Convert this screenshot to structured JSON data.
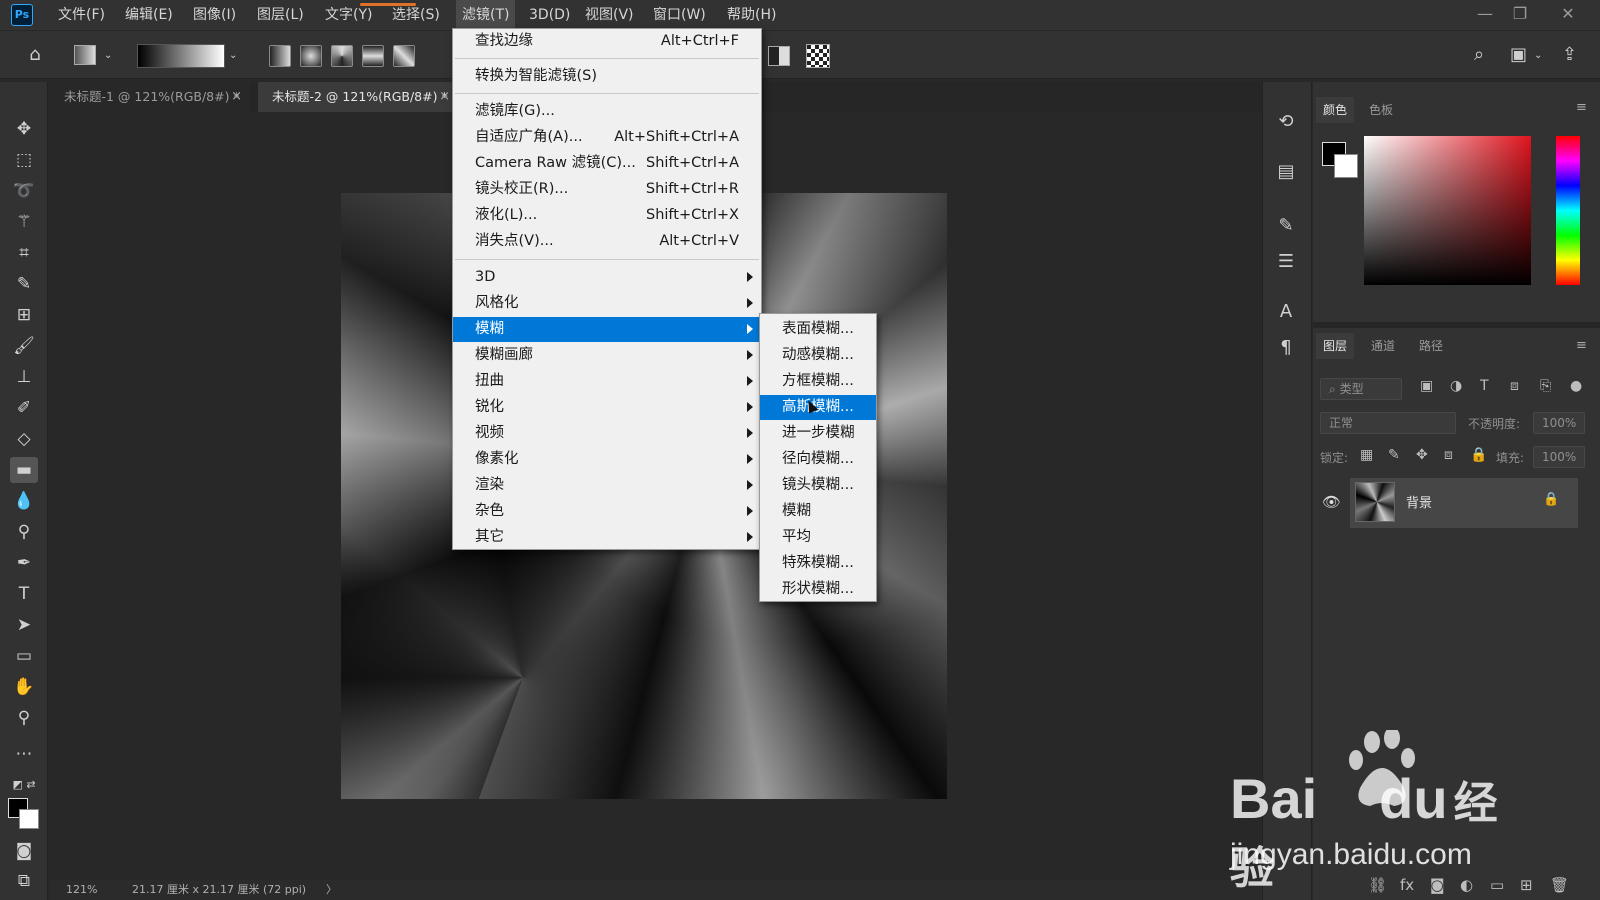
{
  "app": {
    "logo": "Ps"
  },
  "menubar": {
    "items": [
      {
        "label": "文件(F)"
      },
      {
        "label": "编辑(E)"
      },
      {
        "label": "图像(I)"
      },
      {
        "label": "图层(L)"
      },
      {
        "label": "文字(Y)"
      },
      {
        "label": "选择(S)"
      },
      {
        "label": "滤镜(T)"
      },
      {
        "label": "3D(D)"
      },
      {
        "label": "视图(V)"
      },
      {
        "label": "窗口(W)"
      },
      {
        "label": "帮助(H)"
      }
    ],
    "window_controls": {
      "minimize": "—",
      "restore": "❐",
      "close": "✕"
    }
  },
  "tabs": [
    {
      "label": "未标题-1 @ 121%(RGB/8#) *",
      "close": "×"
    },
    {
      "label": "未标题-2 @ 121%(RGB/8#) *",
      "close": "×"
    }
  ],
  "filter_menu": {
    "items": [
      {
        "label": "查找边缘",
        "shortcut": "Alt+Ctrl+F"
      },
      {
        "label": "转换为智能滤镜(S)",
        "shortcut": ""
      },
      {
        "label": "滤镜库(G)...",
        "shortcut": ""
      },
      {
        "label": "自适应广角(A)...",
        "shortcut": "Alt+Shift+Ctrl+A"
      },
      {
        "label": "Camera Raw 滤镜(C)...",
        "shortcut": "Shift+Ctrl+A"
      },
      {
        "label": "镜头校正(R)...",
        "shortcut": "Shift+Ctrl+R"
      },
      {
        "label": "液化(L)...",
        "shortcut": "Shift+Ctrl+X"
      },
      {
        "label": "消失点(V)...",
        "shortcut": "Alt+Ctrl+V"
      },
      {
        "label": "3D",
        "shortcut": ""
      },
      {
        "label": "风格化",
        "shortcut": ""
      },
      {
        "label": "模糊",
        "shortcut": ""
      },
      {
        "label": "模糊画廊",
        "shortcut": ""
      },
      {
        "label": "扭曲",
        "shortcut": ""
      },
      {
        "label": "锐化",
        "shortcut": ""
      },
      {
        "label": "视频",
        "shortcut": ""
      },
      {
        "label": "像素化",
        "shortcut": ""
      },
      {
        "label": "渲染",
        "shortcut": ""
      },
      {
        "label": "杂色",
        "shortcut": ""
      },
      {
        "label": "其它",
        "shortcut": ""
      }
    ]
  },
  "blur_submenu": {
    "items": [
      {
        "label": "表面模糊..."
      },
      {
        "label": "动感模糊..."
      },
      {
        "label": "方框模糊..."
      },
      {
        "label": "高斯模糊..."
      },
      {
        "label": "进一步模糊"
      },
      {
        "label": "径向模糊..."
      },
      {
        "label": "镜头模糊..."
      },
      {
        "label": "模糊"
      },
      {
        "label": "平均"
      },
      {
        "label": "特殊模糊..."
      },
      {
        "label": "形状模糊..."
      }
    ]
  },
  "status": {
    "zoom": "121%",
    "doc_info": "21.17 厘米 x 21.17 厘米 (72 ppi)",
    "arrow": "〉"
  },
  "color_panel": {
    "tabs": [
      "颜色",
      "色板"
    ]
  },
  "layers_panel": {
    "tabs": [
      "图层",
      "通道",
      "路径"
    ],
    "filter_placeholder": "类型",
    "blend_mode": "正常",
    "opacity_label": "不透明度:",
    "opacity_value": "100%",
    "lock_label": "锁定:",
    "fill_label": "填充:",
    "fill_value": "100%",
    "layers": [
      {
        "name": "背景"
      }
    ]
  },
  "watermark": {
    "brand": "Bai",
    "brand2": "du",
    "cn": "经验",
    "url": "jingyan.baidu.com"
  }
}
